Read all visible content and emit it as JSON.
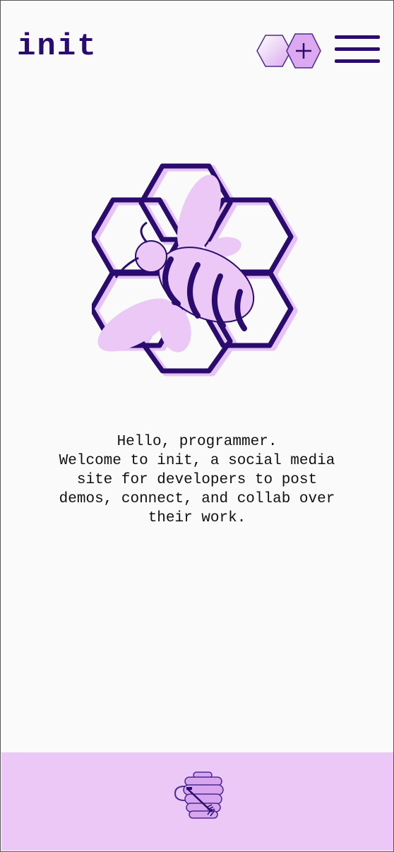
{
  "header": {
    "logo_text": "init",
    "add_icon": "hexagon-plus-icon",
    "menu_icon": "hamburger-menu-icon"
  },
  "hero": {
    "image_icon": "bee-honeycomb-icon"
  },
  "welcome": {
    "lines": [
      "Hello, programmer.",
      "Welcome to init, a social media",
      "site for developers to post",
      "demos, connect, and collab over",
      "their work."
    ]
  },
  "footer": {
    "icon": "honey-pot-icon"
  },
  "colors": {
    "brand_dark": "#2a0c6e",
    "brand_light": "#ebc8f5",
    "background": "#fafafa"
  }
}
